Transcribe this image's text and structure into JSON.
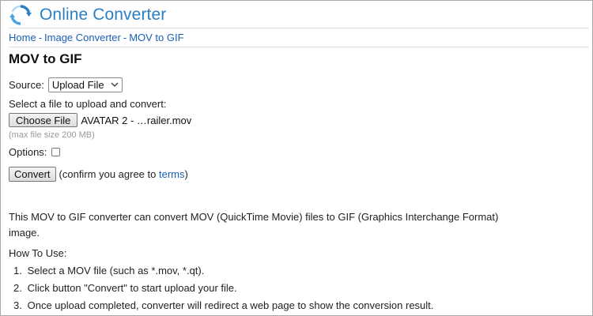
{
  "site": {
    "title": "Online Converter",
    "logo_icon": "refresh-arrows-icon",
    "accent_color": "#2a7fc4"
  },
  "breadcrumb": {
    "items": [
      "Home",
      "Image Converter",
      "MOV to GIF"
    ],
    "separator": "-"
  },
  "page": {
    "title": "MOV to GIF"
  },
  "form": {
    "source_label": "Source:",
    "source_value": "Upload File",
    "select_file_label": "Select a file to upload and convert:",
    "choose_file_label": "Choose File",
    "file_name": "AVATAR 2 - …railer.mov",
    "max_size_hint": "(max file size 200 MB)",
    "options_label": "Options:",
    "options_checked": false,
    "convert_label": "Convert",
    "confirm_prefix": "(confirm you agree to ",
    "terms_label": "terms",
    "confirm_suffix": ")"
  },
  "description": "This MOV to GIF converter can convert MOV (QuickTime Movie) files to GIF (Graphics Interchange Format) image.",
  "how_to": {
    "title": "How To Use:",
    "steps": [
      {
        "num": "1.",
        "text": "Select a MOV file (such as *.mov, *.qt)."
      },
      {
        "num": "2.",
        "text": "Click button \"Convert\" to start upload your file."
      },
      {
        "num": "3.",
        "text": "Once upload completed, converter will redirect a web page to show the conversion result."
      }
    ]
  }
}
